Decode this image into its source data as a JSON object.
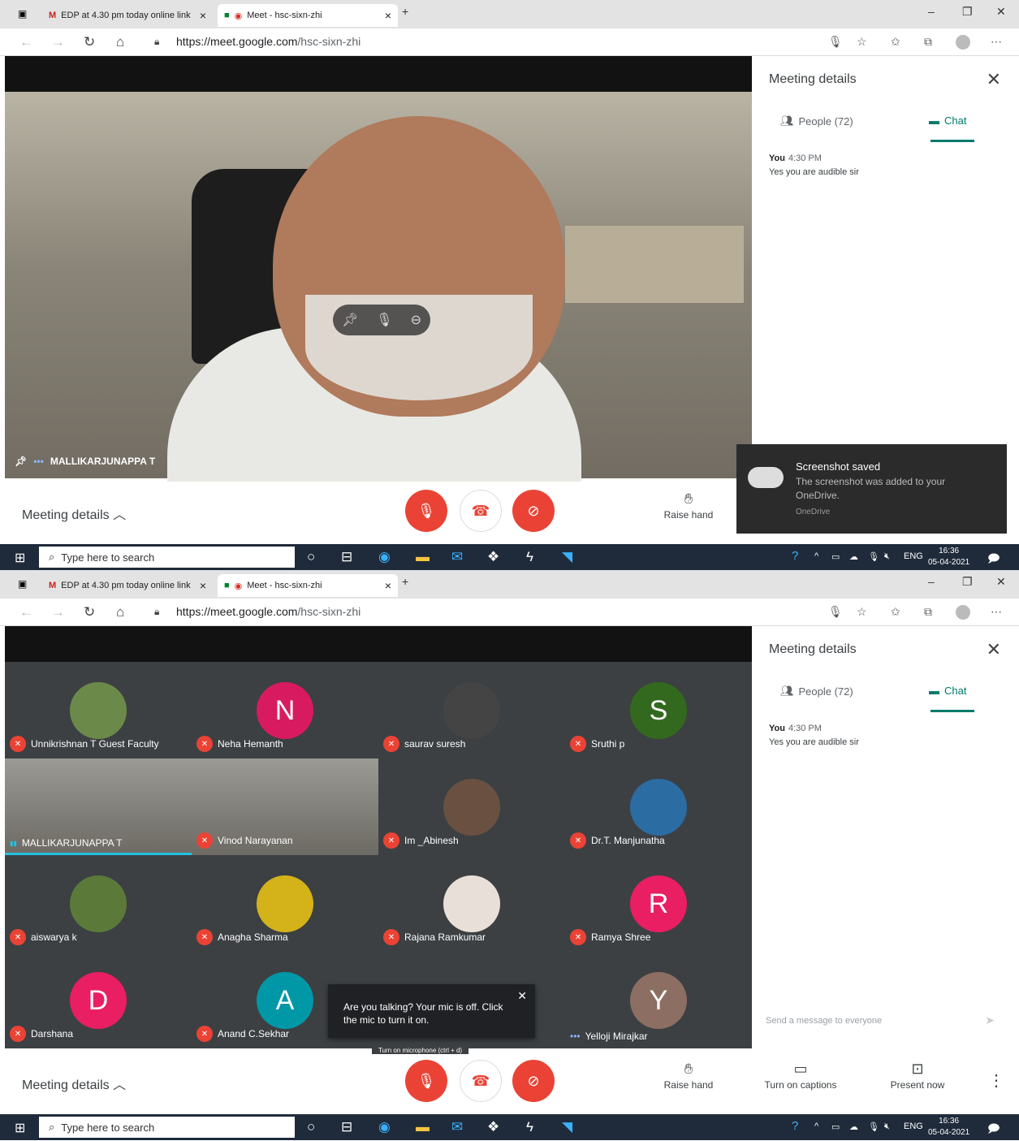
{
  "browser": {
    "tab1_label": "EDP at 4.30 pm today online link",
    "tab2_label": "Meet - hsc-sixn-zhi",
    "url_domain": "https://meet.google.com",
    "url_path": "/hsc-sixn-zhi"
  },
  "panel": {
    "title": "Meeting details",
    "people_tab": "People (72)",
    "chat_tab": "Chat",
    "message_sender": "You",
    "message_time": "4:30 PM",
    "message_text": "Yes you are audible sir",
    "send_placeholder": "Send a message to everyone"
  },
  "bottombar": {
    "meeting_details": "Meeting details",
    "raise_hand": "Raise hand",
    "captions": "Turn on captions",
    "present": "Present now"
  },
  "speaker": {
    "name": "MALLIKARJUNAPPA T"
  },
  "toast": {
    "title": "Screenshot saved",
    "body": "The screenshot was added to your OneDrive.",
    "source": "OneDrive"
  },
  "taskbar": {
    "search_placeholder": "Type here to search",
    "lang": "ENG",
    "time": "16:36",
    "date": "05-04-2021"
  },
  "participants": [
    {
      "name": "Unnikrishnan T Guest Faculty",
      "initial": "",
      "color": "#6b8a4a"
    },
    {
      "name": "Neha Hemanth",
      "initial": "N",
      "color": "#d81b60"
    },
    {
      "name": "saurav suresh",
      "initial": "",
      "color": "#444444"
    },
    {
      "name": "Sruthi p",
      "initial": "S",
      "color": "#33691e"
    },
    {
      "name": "MALLIKARJUNAPPA T",
      "initial": "",
      "color": "#8d8a80"
    },
    {
      "name": "Vinod Narayanan",
      "initial": "",
      "color": "#7a7870"
    },
    {
      "name": "Im _Abinesh",
      "initial": "",
      "color": "#6a5040"
    },
    {
      "name": "Dr.T. Manjunatha",
      "initial": "",
      "color": "#2b6ca3"
    },
    {
      "name": "aiswarya k",
      "initial": "",
      "color": "#5b7a3a"
    },
    {
      "name": "Anagha Sharma",
      "initial": "",
      "color": "#d4b21a"
    },
    {
      "name": "Rajana Ramkumar",
      "initial": "",
      "color": "#e8e0d8"
    },
    {
      "name": "Ramya Shree",
      "initial": "R",
      "color": "#e91e63"
    },
    {
      "name": "Darshana",
      "initial": "D",
      "color": "#e91e63"
    },
    {
      "name": "Anand C.Sekhar",
      "initial": "A",
      "color": "#0097a7"
    },
    {
      "name": "",
      "initial": "",
      "color": "#3c4043"
    },
    {
      "name": "Yelloji Mirajkar",
      "initial": "Y",
      "color": "#8d6e63"
    }
  ],
  "tooltip": {
    "text": "Are you talking? Your mic is off. Click the mic to turn it on.",
    "shortcut": "Turn on microphone (ctrl + d)"
  }
}
